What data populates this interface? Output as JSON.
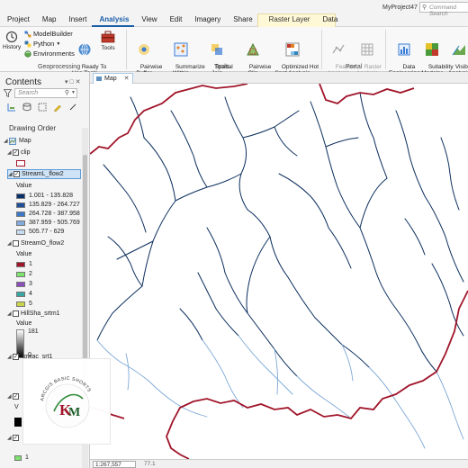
{
  "window": {
    "project_title": "MyProject47",
    "command_search_placeholder": "Command Search"
  },
  "tabs": [
    "Project",
    "Map",
    "Insert",
    "Analysis",
    "View",
    "Edit",
    "Imagery",
    "Share",
    "Raster Layer",
    "Data"
  ],
  "active_tab": "Analysis",
  "ribbon": {
    "geoprocessing": {
      "label": "Geoprocessing",
      "history": "History",
      "modelbuilder": "ModelBuilder",
      "python": "Python",
      "environments": "Environments",
      "ready_to_use": "Ready To\nUse Tools",
      "tools": "Tools"
    },
    "tools_group": {
      "label": "Tools",
      "items": [
        "Pairwise\nBuffer",
        "Summarize\nWithin",
        "Spatial\nJoin",
        "Pairwise\nClip",
        "Optimized Hot\nSpot Analysis"
      ]
    },
    "portal_group": {
      "label": "Portal",
      "items": [
        "Feature\nAnalysis",
        "Raster\nAnalysis"
      ]
    },
    "workflows": [
      "Data\nEngineering",
      "Suitability\nModeler",
      "Visibility\nAnalysis"
    ]
  },
  "contents": {
    "title": "Contents",
    "search_placeholder": "Search",
    "drawing_order": "Drawing Order",
    "map_name": "Map",
    "layers": [
      {
        "name": "clip",
        "checked": true
      },
      {
        "name": "StreamL_flow2",
        "checked": true,
        "selected": true,
        "value_label": "Value",
        "classes": [
          {
            "label": "1.001 - 135.828",
            "color": "#08306b"
          },
          {
            "label": "135.829 - 264.727",
            "color": "#1f4e9a"
          },
          {
            "label": "264.728 - 387.958",
            "color": "#3c78c8"
          },
          {
            "label": "387.959 - 505.769",
            "color": "#82acdc"
          },
          {
            "label": "505.77 - 629",
            "color": "#c6dbf0"
          }
        ]
      },
      {
        "name": "StreamO_flow2",
        "checked": false,
        "value_label": "Value",
        "classes": [
          {
            "label": "1",
            "color": "#a0152a"
          },
          {
            "label": "2",
            "color": "#7ee36e"
          },
          {
            "label": "3",
            "color": "#8a4fb8"
          },
          {
            "label": "4",
            "color": "#3aa6a3"
          },
          {
            "label": "5",
            "color": "#c9d44a"
          }
        ]
      },
      {
        "name": "HillSha_srtm1",
        "checked": false,
        "value_label": "Value",
        "high": "181",
        "low": "0"
      },
      {
        "name": "flowac_srt1",
        "checked": true
      }
    ],
    "extra_labels": [
      "V",
      "1"
    ]
  },
  "map": {
    "tab_label": "Map",
    "scale": "1:267,557",
    "coords": "77.1",
    "boundary_color": "#a0152a"
  },
  "watermark": {
    "text_arc": "ARCGIS BASIC SHORTS",
    "initials": "KM"
  }
}
